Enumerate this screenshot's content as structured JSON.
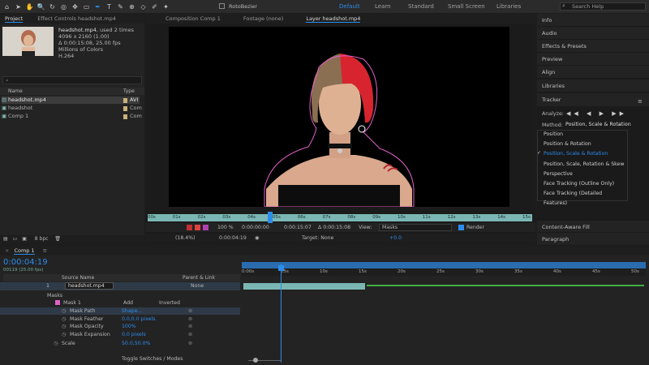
{
  "toolbar": {
    "rotobezier_label": "RotoBezier",
    "workspaces": [
      "Default",
      "Learn",
      "Standard",
      "Small Screen",
      "Libraries"
    ],
    "search_placeholder": "Search Help"
  },
  "project": {
    "tab_project": "Project",
    "tab_effect_controls": "Effect Controls headshot.mp4",
    "file_name": "headshot.mp4",
    "used_times": ", used 2 times",
    "resolution": "4096 x 2160 (1.00)",
    "duration": "Δ 0:00:15:08, 25.00 fps",
    "colors": "Millions of Colors",
    "codec": "H.264",
    "col_name": "Name",
    "col_type": "Type",
    "items": [
      {
        "name": "headshot.mp4",
        "type": "AVI"
      },
      {
        "name": "headshot",
        "type": "Com"
      },
      {
        "name": "Comp 1",
        "type": "Com"
      }
    ],
    "bpc": "8 bpc"
  },
  "viewer": {
    "tab_comp": "Composition Comp 1",
    "tab_footage": "Footage (none)",
    "tab_layer": "Layer headshot.mp4",
    "ruler_labels": [
      "00s",
      "01s",
      "02s",
      "03s",
      "04s",
      "05s",
      "06s",
      "07s",
      "08s",
      "09s",
      "10s",
      "11s",
      "12s",
      "13s",
      "14s",
      "15s"
    ],
    "zoom": "(18.4%)",
    "timecode": "0:00:04:19",
    "in_point": "0:00:00:00",
    "out_point": "0:00:15:07",
    "duration": "Δ 0:00:15:08",
    "view_label": "View:",
    "view_value": "Masks",
    "render_label": "Render",
    "target_label": "Target: None",
    "exposure": "+0.0",
    "percent": "100 %"
  },
  "right_panel": {
    "items": [
      "Info",
      "Audio",
      "Effects & Presets",
      "Preview",
      "Align",
      "Libraries",
      "Tracker"
    ],
    "analyze_label": "Analyze:",
    "method_label": "Method:",
    "method_value": "Position, Scale & Rotation",
    "dropdown": [
      "Position",
      "Position & Rotation",
      "Position, Scale & Rotation",
      "Position, Scale, Rotation & Skew",
      "Perspective",
      "Face Tracking (Outline Only)",
      "Face Tracking (Detailed Features)"
    ],
    "bottom_items": [
      "Content-Aware Fill",
      "Paragraph"
    ]
  },
  "timeline": {
    "tab": "Comp 1",
    "timecode": "0:00:04:19",
    "fps": "00119 (25.00 fps)",
    "col_source": "Source Name",
    "col_parent": "Parent & Link",
    "layer_number": "1",
    "layer_name": "headshot.mp4",
    "parent_value": "None",
    "masks_label": "Masks",
    "mask_name": "Mask 1",
    "mask_mode": "Add",
    "inverted_label": "Inverted",
    "props": [
      {
        "name": "Mask Path",
        "value": "Shape..."
      },
      {
        "name": "Mask Feather",
        "value": "0.0,0.0 pixels"
      },
      {
        "name": "Mask Opacity",
        "value": "100%"
      },
      {
        "name": "Mask Expansion",
        "value": "0.0 pixels"
      },
      {
        "name": "Scale",
        "value": "50.0,50.0%"
      }
    ],
    "ruler_labels": [
      "0:00s",
      "05s",
      "10s",
      "15s",
      "20s",
      "25s",
      "30s",
      "35s",
      "40s",
      "45s",
      "50s"
    ],
    "toggle_label": "Toggle Switches / Modes"
  },
  "colors": {
    "accent": "#2d8ceb",
    "ruler_teal": "#7ab7b4",
    "mask_pink": "#e060c8",
    "green": "#3fb03f"
  }
}
